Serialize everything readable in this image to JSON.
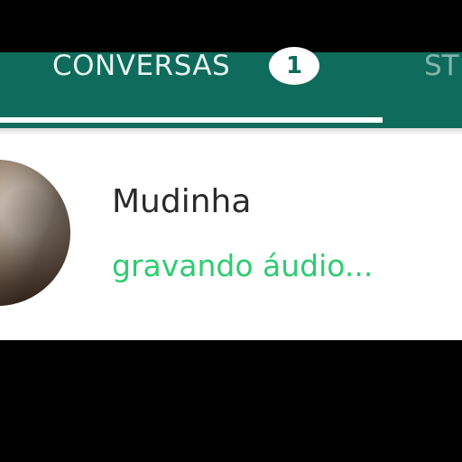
{
  "tabs": {
    "conversas": {
      "label": "CONVERSAS",
      "badge": "1"
    },
    "status": {
      "label": "ST"
    }
  },
  "chat": {
    "contact_name": "Mudinha",
    "status_text": "gravando áudio..."
  },
  "colors": {
    "header_green": "#0f6b5b",
    "typing_green": "#2ecc71",
    "background": "#ffffff"
  }
}
